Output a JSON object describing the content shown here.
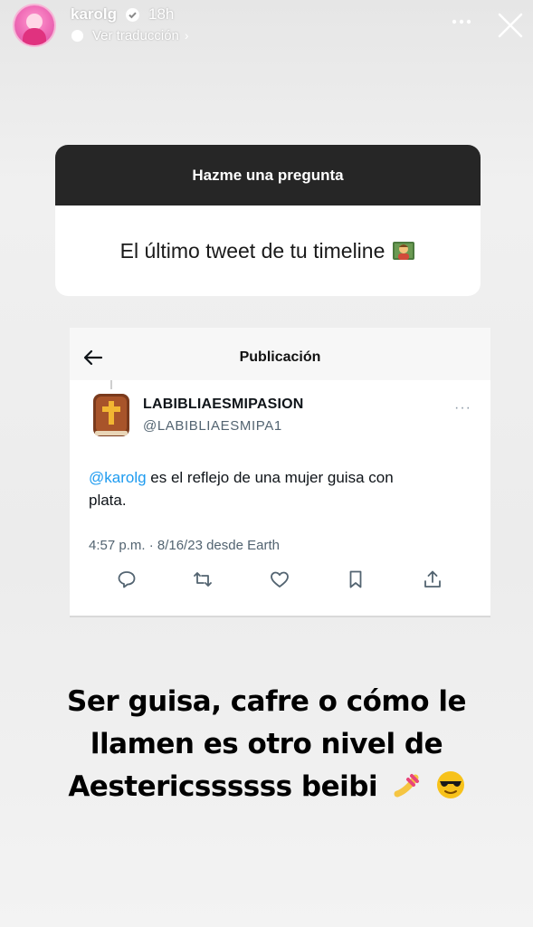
{
  "header": {
    "username": "karolg",
    "time": "18h",
    "translate_label": "Ver traducción"
  },
  "question_card": {
    "title": "Hazme una pregunta",
    "question": "El último tweet de tu timeline"
  },
  "tweet": {
    "topbar_title": "Publicación",
    "display_name": "LABIBLIAESMIPASION",
    "handle": "@LABIBLIAESMIPA1",
    "mention": "@karolg",
    "text_line1": " es el reflejo de una mujer guisa con",
    "text_line2": "plata.",
    "meta": "4:57 p.m. · 8/16/23 desde Earth",
    "more": "···"
  },
  "caption": {
    "line1": "Ser guisa, cafre o cómo le",
    "line2": "llamen es otro nivel de",
    "line3": "Aestericssssss beibi"
  },
  "colors": {
    "mention": "#1d9bf0",
    "question_header": "#262626"
  }
}
